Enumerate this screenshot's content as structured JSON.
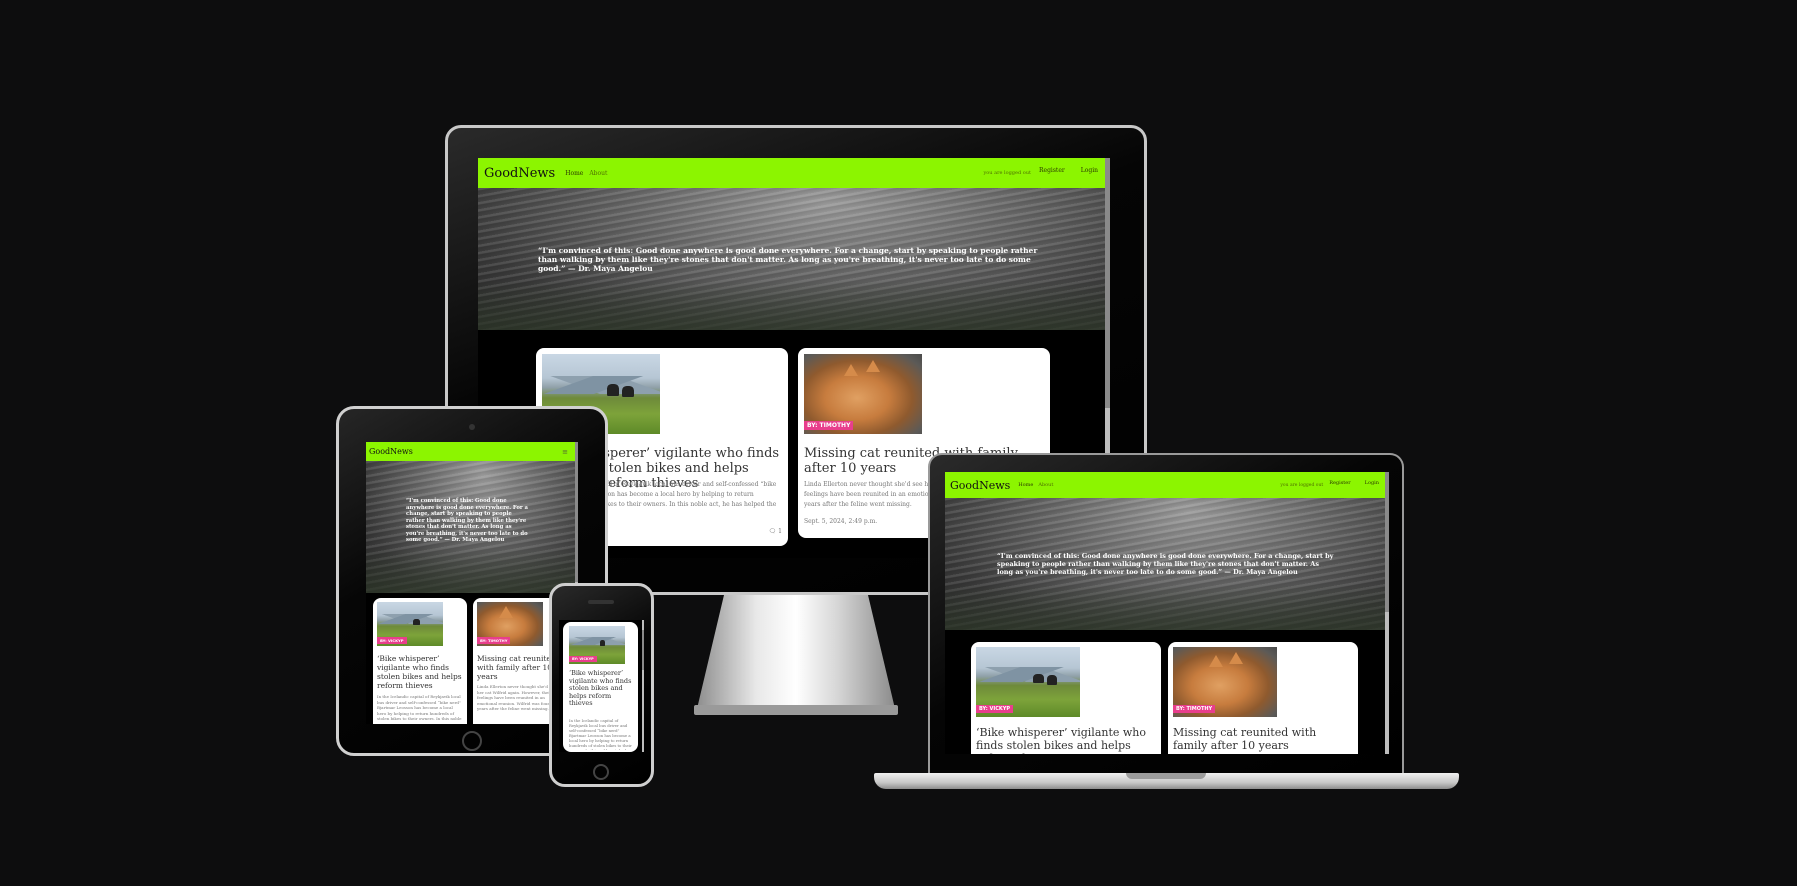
{
  "site": {
    "brand": "GoodNews",
    "nav_home": "Home",
    "nav_about": "About",
    "logged_out": "you are logged out",
    "register": "Register",
    "login": "Login",
    "menu_icon": "≡",
    "hero_quote": "“I'm convinced of this: Good done anywhere is good done everywhere. For a change, start by speaking to people rather than walking by them like they're stones that don't matter. As long as you're breathing, it's never too late to do some good.” — Dr. Maya Angelou"
  },
  "posts": [
    {
      "author": "BY: VICKYP",
      "title": "‘Bike whisperer’ vigilante who finds stolen bikes and helps reform thieves",
      "excerpt": "In the Icelandic capital of Reykjavik local bus driver and self-confessed “bike nerd” Bjartmar Leosson has become a local hero by helping to return hundreds of stolen bikes to their owners. In this noble act, he has helped the bike thieves to reform in return.",
      "comments": "1"
    },
    {
      "author": "BY: TIMOTHY",
      "title": "Missing cat reunited with family after 10 years",
      "excerpt": "Linda Ellerton never thought she'd see her cat Wilfrid again. However, their feelings have been reunited in an emotional reunion. Wilfrid was found 10 years after the feline went missing.",
      "date": "Sept. 5, 2024, 2:49 p.m."
    }
  ],
  "colors": {
    "nav_green": "#8cf500",
    "badge_pink": "#e83e8c",
    "background": "#0d0d0e"
  }
}
